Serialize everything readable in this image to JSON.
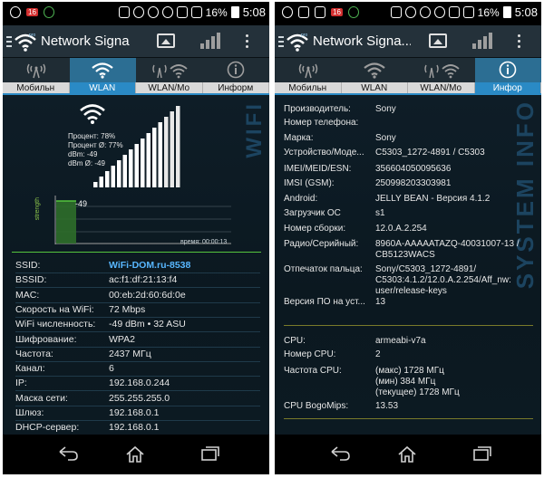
{
  "status_bar": {
    "badge": "16",
    "battery": "16%",
    "time": "5:08"
  },
  "app": {
    "title": "Network Signal...",
    "title_short": "Network Signa",
    "title_short2": "Network Signa..."
  },
  "tabs": [
    {
      "label": "Мобильн",
      "icon": "cell-tower-icon"
    },
    {
      "label": "WLAN",
      "icon": "wifi-icon"
    },
    {
      "label": "WLAN/Мо",
      "icon": "tower-wifi-icon"
    },
    {
      "label": "Информ",
      "icon": "info-icon"
    }
  ],
  "tabs2": [
    {
      "label": "Мобильн"
    },
    {
      "label": "WLAN"
    },
    {
      "label": "WLAN/Мо"
    },
    {
      "label": "Инфор"
    }
  ],
  "wifi_panel": {
    "watermark": "WIFI",
    "stats": [
      "Процент: 78%",
      "Процент Ø: 77%",
      "dBm: -49",
      "dBm Ø: -49"
    ],
    "signal_label": "strength",
    "signal_value": "-49",
    "time_label": "время: 00:00:13",
    "percent": 78,
    "rows": [
      {
        "k": "SSID:",
        "v": "WiFi-DOM.ru-8538",
        "link": true
      },
      {
        "k": "BSSID:",
        "v": "ac:f1:df:21:13:f4"
      },
      {
        "k": "MAC:",
        "v": "00:eb:2d:60:6d:0e"
      },
      {
        "k": "Скорость на WiFi:",
        "v": "72 Mbps"
      },
      {
        "k": "WiFi численность:",
        "v": "-49 dBm • 32 ASU"
      },
      {
        "k": "Шифрование:",
        "v": "WPA2"
      },
      {
        "k": "Частота:",
        "v": "2437 МГц"
      },
      {
        "k": "Канал:",
        "v": "6"
      },
      {
        "k": "IP:",
        "v": "192.168.0.244"
      },
      {
        "k": "Маска сети:",
        "v": "255.255.255.0"
      },
      {
        "k": "Шлюз:",
        "v": "192.168.0.1"
      },
      {
        "k": "DHCP-сервер:",
        "v": "192.168.0.1"
      }
    ]
  },
  "info_panel": {
    "watermark": "SYSTEM INFO",
    "rows": [
      {
        "k": "Производитель:",
        "v": "Sony"
      },
      {
        "k": "Номер телефона:",
        "v": ""
      },
      {
        "k": "Марка:",
        "v": "Sony"
      },
      {
        "k": "Устройство/Моде...",
        "v": "C5303_1272-4891 / C5303"
      },
      {
        "k": "IMEI/MEID/ESN:",
        "v": "356604050095636"
      },
      {
        "k": "IMSI (GSM):",
        "v": "250998203303981"
      },
      {
        "k": "Android:",
        "v": "JELLY BEAN - Версия 4.1.2"
      },
      {
        "k": "Загрузчик ОС",
        "v": "s1"
      },
      {
        "k": "Номер сборки:",
        "v": "12.0.A.2.254"
      },
      {
        "k": "Радио/Серийный:",
        "v": "8960A-AAAAATAZQ-40031007-13 / CB5123WACS"
      },
      {
        "k": "Отпечаток пальца:",
        "v": "Sony/C5303_1272-4891/ C5303:4.1.2/12.0.A.2.254/Aff_nw: user/release-keys"
      },
      {
        "k": "Версия ПО на уст...",
        "v": "13"
      }
    ],
    "cpu_rows": [
      {
        "k": "CPU:",
        "v": "armeabi-v7a"
      },
      {
        "k": "Номер CPU:",
        "v": "2"
      },
      {
        "k": "Частота CPU:",
        "v": "(макс) 1728 МГц\n(мин) 384 МГц\n(текущее) 1728 МГц"
      },
      {
        "k": "CPU BogoMips:",
        "v": "13.53"
      }
    ]
  },
  "colors": {
    "accent": "#2a8ac5",
    "link": "#58b7ff",
    "graph": "#55c53d"
  }
}
